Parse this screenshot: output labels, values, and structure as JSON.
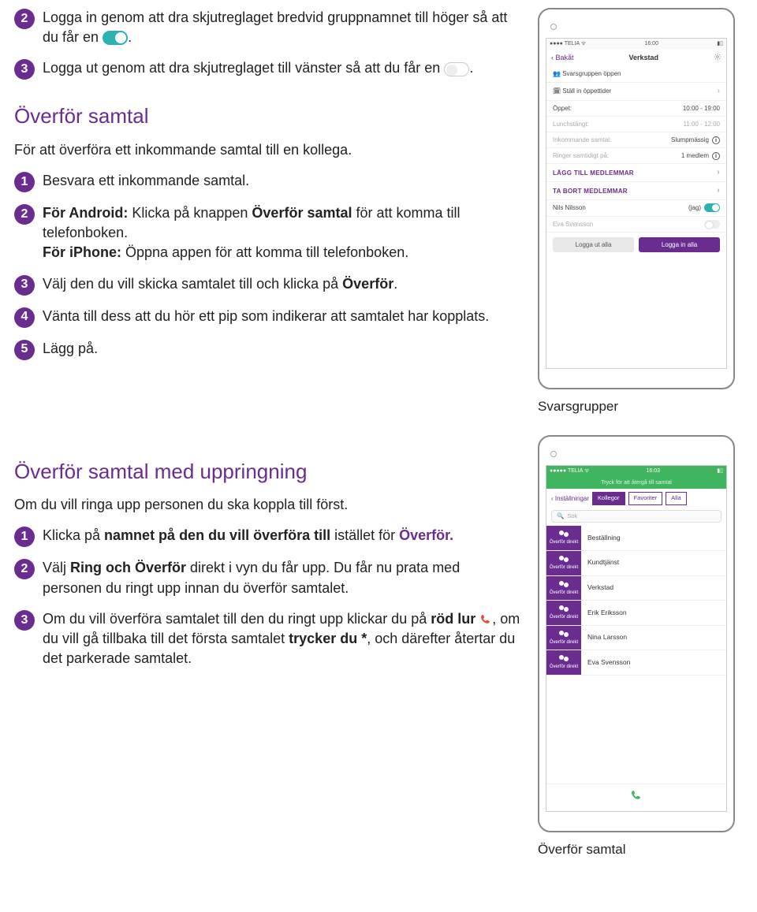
{
  "intro_steps": [
    {
      "num": "2",
      "pre": "Logga in genom att dra skjutreglaget bredvid gruppnamnet till höger så att du får en ",
      "after": ".",
      "toggle": "on"
    },
    {
      "num": "3",
      "pre": "Logga ut genom att dra skjutreglaget till vänster så att du får en ",
      "after": ".",
      "toggle": "off"
    }
  ],
  "section1": {
    "title": "Överför samtal",
    "intro": "För att överföra ett inkommande samtal till en kollega.",
    "steps": [
      {
        "num": "1",
        "text": "Besvara ett inkommande samtal."
      },
      {
        "num": "2",
        "line1_pre": "För Android: ",
        "line1_mid": "Klicka på knappen ",
        "line1_b": "Överför samtal",
        "line1_post": " för att komma till telefonboken.",
        "line2_pre": "För iPhone: ",
        "line2_post": "Öppna appen för att komma till telefonboken."
      },
      {
        "num": "3",
        "pre": "Välj den du vill skicka samtalet till och klicka på ",
        "b": "Överför",
        "post": "."
      },
      {
        "num": "4",
        "text": "Vänta till dess att du hör ett pip som indikerar att samtalet har kopplats."
      },
      {
        "num": "5",
        "text": "Lägg på."
      }
    ]
  },
  "section2": {
    "title": "Överför samtal med uppringning",
    "intro": "Om du vill ringa upp personen du ska koppla till först.",
    "steps": [
      {
        "num": "1",
        "pre": "Klicka på ",
        "b1": "namnet på den du vill överföra till",
        "mid": " istället för ",
        "b2": "Överför.",
        "post": ""
      },
      {
        "num": "2",
        "pre": "Välj ",
        "b": "Ring och Överför",
        "post": " direkt i vyn du får upp. Du får nu prata med personen du ringt upp innan du överför samtalet."
      },
      {
        "num": "3",
        "pre": "Om du vill överföra samtalet till den du ringt upp klickar du på ",
        "b1": "röd lur ",
        "mid": ", om du vill gå tillbaka till det första samtalet ",
        "b2": "trycker du *",
        "post": ", och därefter återtar du det parkerade samtalet."
      }
    ]
  },
  "phone1": {
    "carrier": "TELIA",
    "time": "16:00",
    "back": "Bakåt",
    "title": "Verkstad",
    "rows": {
      "svarsgrupp": "Svarsgruppen öppen",
      "stall": "Ställ in öppettider",
      "oppet_l": "Öppet:",
      "oppet_v": "10:00 - 19:00",
      "lunch_l": "Lunchstängt:",
      "lunch_v": "11:00 - 12:00",
      "ink_l": "Inkommande samtal:",
      "ink_v": "Slumpmässig",
      "ringer_l": "Ringer samtidigt på:",
      "ringer_v": "1 medlem",
      "lagg": "LÄGG TILL MEDLEMMAR",
      "tabort": "TA BORT MEDLEMMAR",
      "m1_name": "Nils Nilsson",
      "m1_tag": "(jag)",
      "m2_name": "Eva Svensson",
      "btn_out": "Logga ut alla",
      "btn_in": "Logga in alla"
    },
    "caption": "Svarsgrupper"
  },
  "phone2": {
    "carrier": "TELIA",
    "time": "16:03",
    "greenline": "Tryck för att återgå till samtal",
    "back": "Inställningar",
    "tabs": {
      "kollegor": "Kollegor",
      "favoriter": "Favoriter",
      "alla": "Alla"
    },
    "search": "Sök",
    "side_label": "Överför direkt",
    "contacts": [
      "Beställning",
      "Kundtjänst",
      "Verkstad",
      "Erik Eriksson",
      "Nina Larsson",
      "Eva Svensson"
    ],
    "caption": "Överför samtal"
  }
}
